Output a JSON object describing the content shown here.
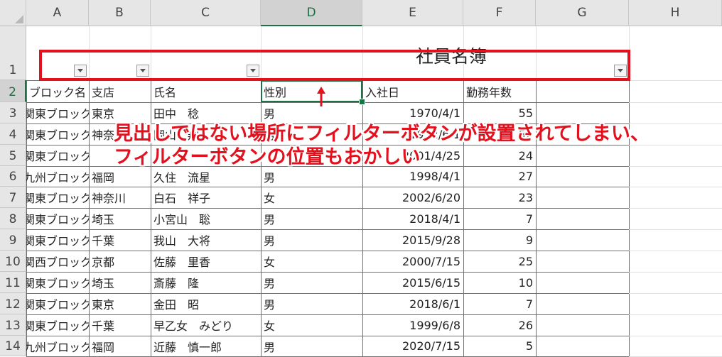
{
  "columns": [
    "A",
    "B",
    "C",
    "D",
    "E",
    "F",
    "G",
    "H"
  ],
  "rows": [
    "1",
    "2",
    "3",
    "4",
    "5",
    "6",
    "7",
    "8",
    "9",
    "10",
    "11",
    "12",
    "13",
    "14"
  ],
  "sheet_title": "社員名簿",
  "headers": [
    "ブロック名",
    "支店",
    "氏名",
    "性別",
    "入社日",
    "勤務年数"
  ],
  "data_rows": [
    [
      "関東ブロック",
      "東京",
      "田中　稔",
      "男",
      "1970/4/1",
      "55"
    ],
    [
      "関東ブロック",
      "神奈川",
      "岡山　翔",
      "男",
      "1972/6/1",
      "52"
    ],
    [
      "関東ブロック",
      "",
      "",
      "",
      "2001/4/25",
      "24"
    ],
    [
      "九州ブロック",
      "福岡",
      "久住　流星",
      "男",
      "1998/4/1",
      "27"
    ],
    [
      "関東ブロック",
      "神奈川",
      "白石　祥子",
      "女",
      "2002/6/20",
      "23"
    ],
    [
      "関東ブロック",
      "埼玉",
      "小宮山　聡",
      "男",
      "2018/4/1",
      "7"
    ],
    [
      "関東ブロック",
      "千葉",
      "我山　大将",
      "男",
      "2015/9/28",
      "9"
    ],
    [
      "関西ブロック",
      "京都",
      "佐藤　里香",
      "女",
      "2000/7/15",
      "25"
    ],
    [
      "関東ブロック",
      "埼玉",
      "斎藤　隆",
      "男",
      "2015/6/15",
      "10"
    ],
    [
      "関東ブロック",
      "東京",
      "金田　昭",
      "男",
      "2018/6/1",
      "7"
    ],
    [
      "関東ブロック",
      "千葉",
      "早乙女　みどり",
      "女",
      "1999/6/8",
      "26"
    ],
    [
      "九州ブロック",
      "福岡",
      "近藤　慎一郎",
      "男",
      "2020/7/15",
      "5"
    ]
  ],
  "annotation": {
    "line1": "見出しではない場所にフィルターボタンが設置されてしまい、",
    "line2": "フィルターボタンの位置もおかしい"
  },
  "colors": {
    "annotation": "#e3101e",
    "selection": "#1e7145"
  }
}
